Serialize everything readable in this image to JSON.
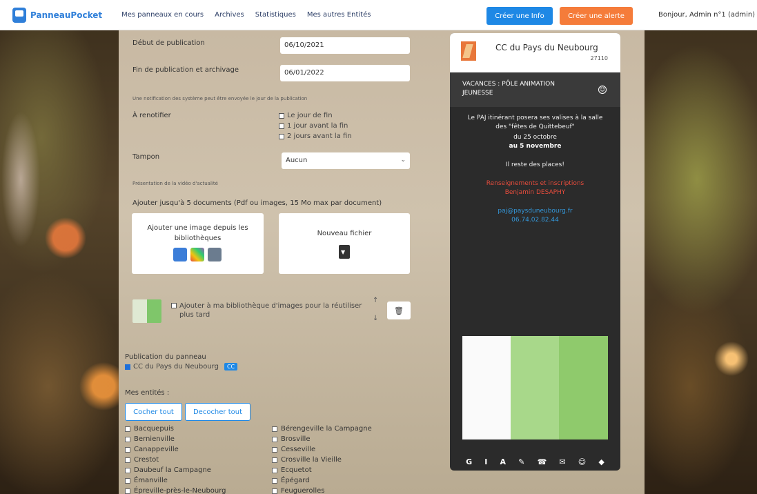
{
  "nav": {
    "brand": "PanneauPocket",
    "links": [
      "Mes panneaux en cours",
      "Archives",
      "Statistiques",
      "Mes autres Entités"
    ],
    "create_info": "Créer une Info",
    "create_alert": "Créer une alerte",
    "greeting": "Bonjour, Admin n°1 (admin) -"
  },
  "form": {
    "start_label": "Début de publication",
    "start_value": "06/10/2021",
    "end_label": "Fin de publication et archivage",
    "end_value": "06/01/2022",
    "notif_note": "Une notification des système peut être envoyée le jour de la publication",
    "remind_label": "À renotifier",
    "remind_options": [
      "Le jour de fin",
      "1 jour avant la fin",
      "2 jours avant la fin"
    ],
    "stamp_label": "Tampon",
    "stamp_value": "Aucun",
    "media_note": "Présentation de la vidéo d'actualité",
    "docs_label": "Ajouter jusqu'à 5 documents (Pdf ou images, 15 Mo max par document)",
    "add_library": "Ajouter une image depuis les bibliothèques",
    "new_file": "Nouveau fichier",
    "add_to_library": "Ajouter à ma bibliothèque d'images pour la réutiliser plus tard",
    "pub_label": "Publication du panneau",
    "pub_entity": "CC du Pays du Neubourg",
    "pub_tag": "CC",
    "entities_label": "Mes entités :",
    "check_all": "Cocher tout",
    "uncheck_all": "Decocher tout",
    "towns_left": [
      "Bacquepuis",
      "Bernienville",
      "Canappeville",
      "Crestot",
      "Daubeuf la Campagne",
      "Émanville",
      "Épreville-près-le-Neubourg"
    ],
    "towns_right": [
      "Bérengeville la Campagne",
      "Brosville",
      "Cesseville",
      "Crosville la Vieille",
      "Ecquetot",
      "Épégard",
      "Feuguerolles"
    ]
  },
  "preview": {
    "entity": "CC du Pays du Neubourg",
    "code": "27110",
    "headline": "VACANCES : PÔLE ANIMATION JEUNESSE",
    "body_1": "Le PAJ itinérant posera ses valises à la salle",
    "body_2": "des \"fêtes de Quittebeuf\"",
    "body_3": "du 25 octobre",
    "body_4": "au 5 novembre",
    "body_5": "Il reste des places!",
    "body_6": "Renseignements et inscriptions",
    "body_7": "Benjamin DESAPHY",
    "body_8": "paj@paysduneubourg.fr",
    "body_9": "06.74.02.82.44",
    "toolbar": [
      "G",
      "I",
      "A",
      "✎",
      "☎",
      "✉",
      "☺",
      "◆"
    ]
  }
}
